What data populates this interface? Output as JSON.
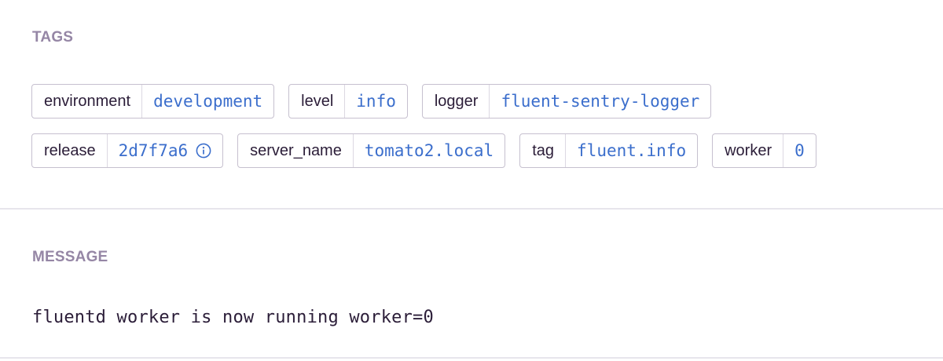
{
  "tags_section": {
    "title": "TAGS",
    "rows": [
      [
        {
          "key": "environment",
          "value": "development"
        },
        {
          "key": "level",
          "value": "info"
        },
        {
          "key": "logger",
          "value": "fluent-sentry-logger"
        }
      ],
      [
        {
          "key": "release",
          "value": "2d7f7a6",
          "icon": "info-icon"
        },
        {
          "key": "server_name",
          "value": "tomato2.local"
        },
        {
          "key": "tag",
          "value": "fluent.info"
        },
        {
          "key": "worker",
          "value": "0"
        }
      ]
    ]
  },
  "message_section": {
    "title": "MESSAGE",
    "text": "fluentd worker is now running worker=0"
  },
  "colors": {
    "section_title": "#9586a5",
    "tag_value": "#3b6ecc",
    "tag_border": "#c6c0cf",
    "divider": "#e7e5ec",
    "text": "#2b1d38"
  }
}
